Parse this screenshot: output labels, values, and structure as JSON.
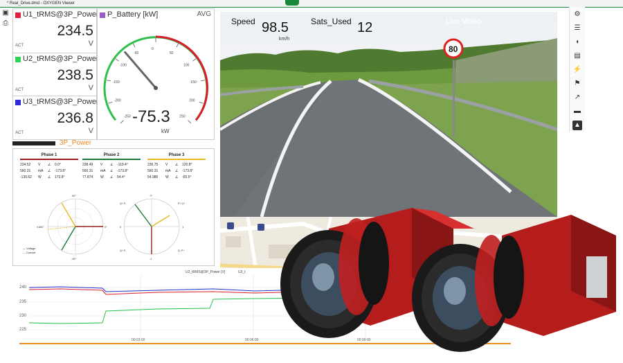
{
  "window": {
    "title": "* Real_Drive.dmd - OXYGEN Viewer"
  },
  "meters": [
    {
      "name": "U1_tRMS@3P_Power",
      "value": "234.5",
      "unit": "V",
      "tag": "ACT",
      "color": "#e0203c"
    },
    {
      "name": "U2_tRMS@3P_Power",
      "value": "238.5",
      "unit": "V",
      "tag": "ACT",
      "color": "#2fcf58"
    },
    {
      "name": "U3_tRMS@3P_Power",
      "value": "236.8",
      "unit": "V",
      "tag": "ACT",
      "color": "#2b2bd6"
    }
  ],
  "gauge": {
    "name": "P_Battery [kW]",
    "mode": "AVG",
    "value": "-75.3",
    "reading": -75.3,
    "unit": "kW",
    "ticks": [
      "-250",
      "-200",
      "-150",
      "-100",
      "-50",
      "0",
      "50",
      "100",
      "150",
      "200",
      "250"
    ],
    "color": "#9a5cc7"
  },
  "strip": {
    "label": "3P_Power"
  },
  "phases": {
    "items": [
      {
        "title": "Phase 1",
        "color": "#9b1b1b",
        "rows": [
          [
            "234.52",
            "V",
            "∠",
            "0.0°"
          ],
          [
            "560.31",
            "mA",
            "∠",
            "-173.8°"
          ],
          [
            "-130.62",
            "W",
            "∠",
            "173.8°"
          ]
        ]
      },
      {
        "title": "Phase 2",
        "color": "#1a7a3a",
        "rows": [
          [
            "238.49",
            "V",
            "∠",
            "-119.4°"
          ],
          [
            "560.31",
            "mA",
            "∠",
            "-173.8°"
          ],
          [
            "77.874",
            "W",
            "∠",
            "54.4°"
          ]
        ]
      },
      {
        "title": "Phase 3",
        "color": "#e8b828",
        "rows": [
          [
            "236.75",
            "V",
            "∠",
            "120.8°"
          ],
          [
            "560.31",
            "mA",
            "∠",
            "-173.8°"
          ],
          [
            "54.985",
            "W",
            "∠",
            "-65.5°"
          ]
        ]
      }
    ],
    "polar1": {
      "top": "90°",
      "bottom": "-90°",
      "left": "±180°",
      "right": "0°"
    },
    "polar2": {
      "top": "P",
      "bottom": "-1",
      "left": "0",
      "right": "1"
    },
    "polar2_q": {
      "q1": "Q+ P-",
      "q2": "P+ Q+",
      "q3": "Q+ P-",
      "q4": "Q- P+"
    },
    "legend": {
      "voltage": "Voltage",
      "current": "Current"
    }
  },
  "video": {
    "speed_label": "Speed",
    "speed_value": "98.5",
    "speed_unit": "km/h",
    "sats_label": "Sats_Used",
    "sats_value": "12",
    "live_label": "Live Video",
    "sign_value": "80"
  },
  "timeline": {
    "yticks": [
      "240",
      "235",
      "230",
      "225"
    ],
    "xticks": [
      "00:03:00",
      "00:06:00",
      "00:09:00"
    ],
    "legend1": "U2_tRMS@3P_Power [V]",
    "legend2": "U3_t",
    "colors": {
      "u1": "#d81e2a",
      "u2": "#22c04a",
      "u3": "#2030c8",
      "accent": "#f08a28"
    }
  }
}
